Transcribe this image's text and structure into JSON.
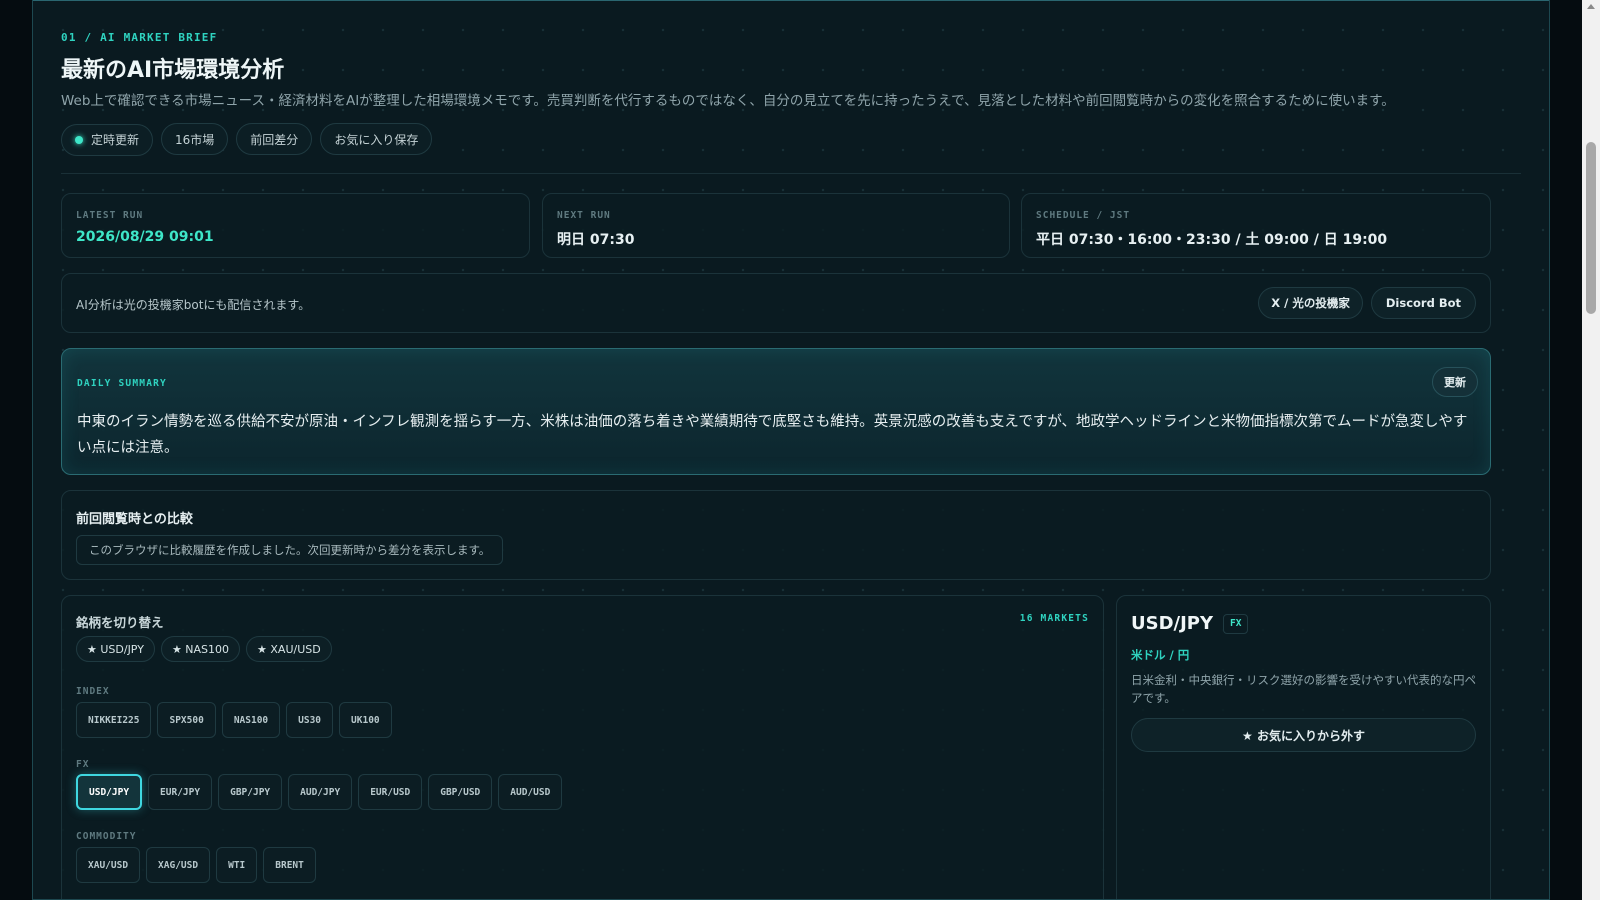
{
  "header": {
    "eyebrow": "01 / AI MARKET BRIEF",
    "title": "最新のAI市場環境分析",
    "description": "Web上で確認できる市場ニュース・経済材料をAIが整理した相場環境メモです。売買判断を代行するものではなく、自分の見立てを先に持ったうえで、見落とした材料や前回閲覧時からの変化を照合するために使います。",
    "pills": [
      "定時更新",
      "16市場",
      "前回差分",
      "お気に入り保存"
    ]
  },
  "run_info": {
    "latest_label": "LATEST RUN",
    "latest_value": "2026/08/29 09:01",
    "next_label": "NEXT RUN",
    "next_value": "明日 07:30",
    "schedule_label": "SCHEDULE / JST",
    "schedule_value": "平日 07:30・16:00・23:30 / 土 09:00 / 日 19:00"
  },
  "distribution": {
    "text": "AI分析は光の投機家botにも配信されます。",
    "x_button": "X / 光の投機家",
    "discord_button": "Discord Bot"
  },
  "summary": {
    "label": "DAILY SUMMARY",
    "refresh": "更新",
    "text": "中東のイラン情勢を巡る供給不安が原油・インフレ観測を揺らす一方、米株は油価の落ち着きや業績期待で底堅さも維持。英景況感の改善も支えですが、地政学ヘッドラインと米物価指標次第でムードが急変しやすい点には注意。"
  },
  "comparison": {
    "title": "前回閲覧時との比較",
    "note": "このブラウザに比較履歴を作成しました。次回更新時から差分を表示します。"
  },
  "selector": {
    "title": "銘柄を切り替え",
    "count": "16 MARKETS",
    "favorites": [
      "★ USD/JPY",
      "★ NAS100",
      "★ XAU/USD"
    ],
    "groups": [
      {
        "label": "INDEX",
        "items": [
          "NIKKEI225",
          "SPX500",
          "NAS100",
          "US30",
          "UK100"
        ]
      },
      {
        "label": "FX",
        "items": [
          "USD/JPY",
          "EUR/JPY",
          "GBP/JPY",
          "AUD/JPY",
          "EUR/USD",
          "GBP/USD",
          "AUD/USD"
        ]
      },
      {
        "label": "COMMODITY",
        "items": [
          "XAU/USD",
          "XAG/USD",
          "WTI",
          "BRENT"
        ]
      }
    ],
    "active": "USD/JPY"
  },
  "detail": {
    "symbol": "USD/JPY",
    "tag": "FX",
    "name": "米ドル / 円",
    "description": "日米金利・中央銀行・リスク選好の影響を受けやすい代表的な円ペアです。",
    "remove_favorite": "★ お気に入りから外す"
  },
  "colors": {
    "accent": "#3ee6c8",
    "background": "#0a1a20",
    "border": "#1b333a",
    "active_chip": "#3fd7e0"
  }
}
